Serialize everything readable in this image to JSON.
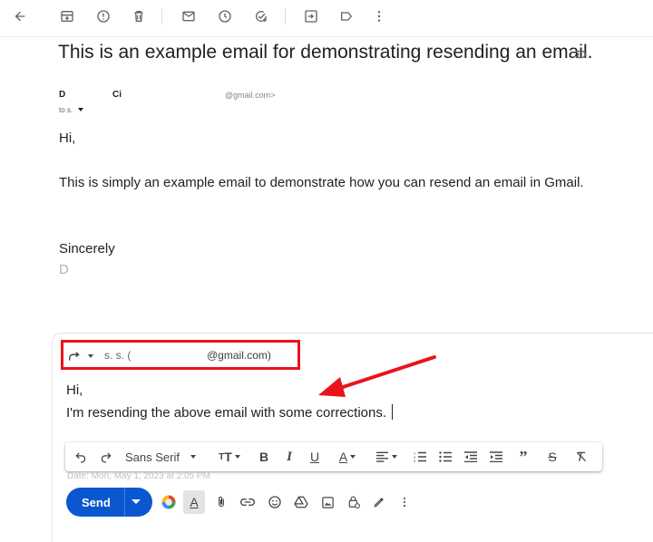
{
  "email": {
    "subject": "This is an example email for demonstrating resending an email.",
    "sender_initial_1": "D",
    "sender_initial_2": "Ci",
    "sender_email_fragment": "@gmail.com>",
    "to_line": "to s.",
    "greeting": "Hi,",
    "body": "This is simply an example email to demonstrate how you can resend an email in Gmail.",
    "closing": "Sincerely",
    "signature_initial": "D"
  },
  "compose": {
    "recipient_name": "s. s. (",
    "recipient_email": "@gmail.com)",
    "line1": "Hi,",
    "line2": "I'm resending the above email with some corrections.",
    "font_select": "Sans Serif",
    "quoted_date_fragment": "Date: Mon, May 1, 2023 at 2:05 PM",
    "send_label": "Send"
  },
  "colors": {
    "annotation_red": "#e8131b",
    "send_blue": "#0b57d0"
  },
  "icons": {
    "toolbar": [
      "back-arrow-icon",
      "archive-icon",
      "report-spam-icon",
      "delete-icon",
      "mark-unread-icon",
      "snooze-icon",
      "add-to-tasks-icon",
      "move-to-icon",
      "label-icon",
      "more-vert-icon"
    ],
    "format": [
      "undo-icon",
      "redo-icon",
      "font-size-icon",
      "bold-icon",
      "italic-icon",
      "underline-icon",
      "text-color-icon",
      "align-icon",
      "numbered-list-icon",
      "bulleted-list-icon",
      "indent-less-icon",
      "indent-more-icon",
      "quote-icon",
      "strikethrough-icon",
      "remove-formatting-icon"
    ],
    "bottom": [
      "color-theme-icon",
      "formatting-options-icon",
      "attach-icon",
      "link-icon",
      "emoji-icon",
      "drive-icon",
      "photo-icon",
      "confidential-lock-icon",
      "signature-icon",
      "more-options-icon"
    ]
  }
}
